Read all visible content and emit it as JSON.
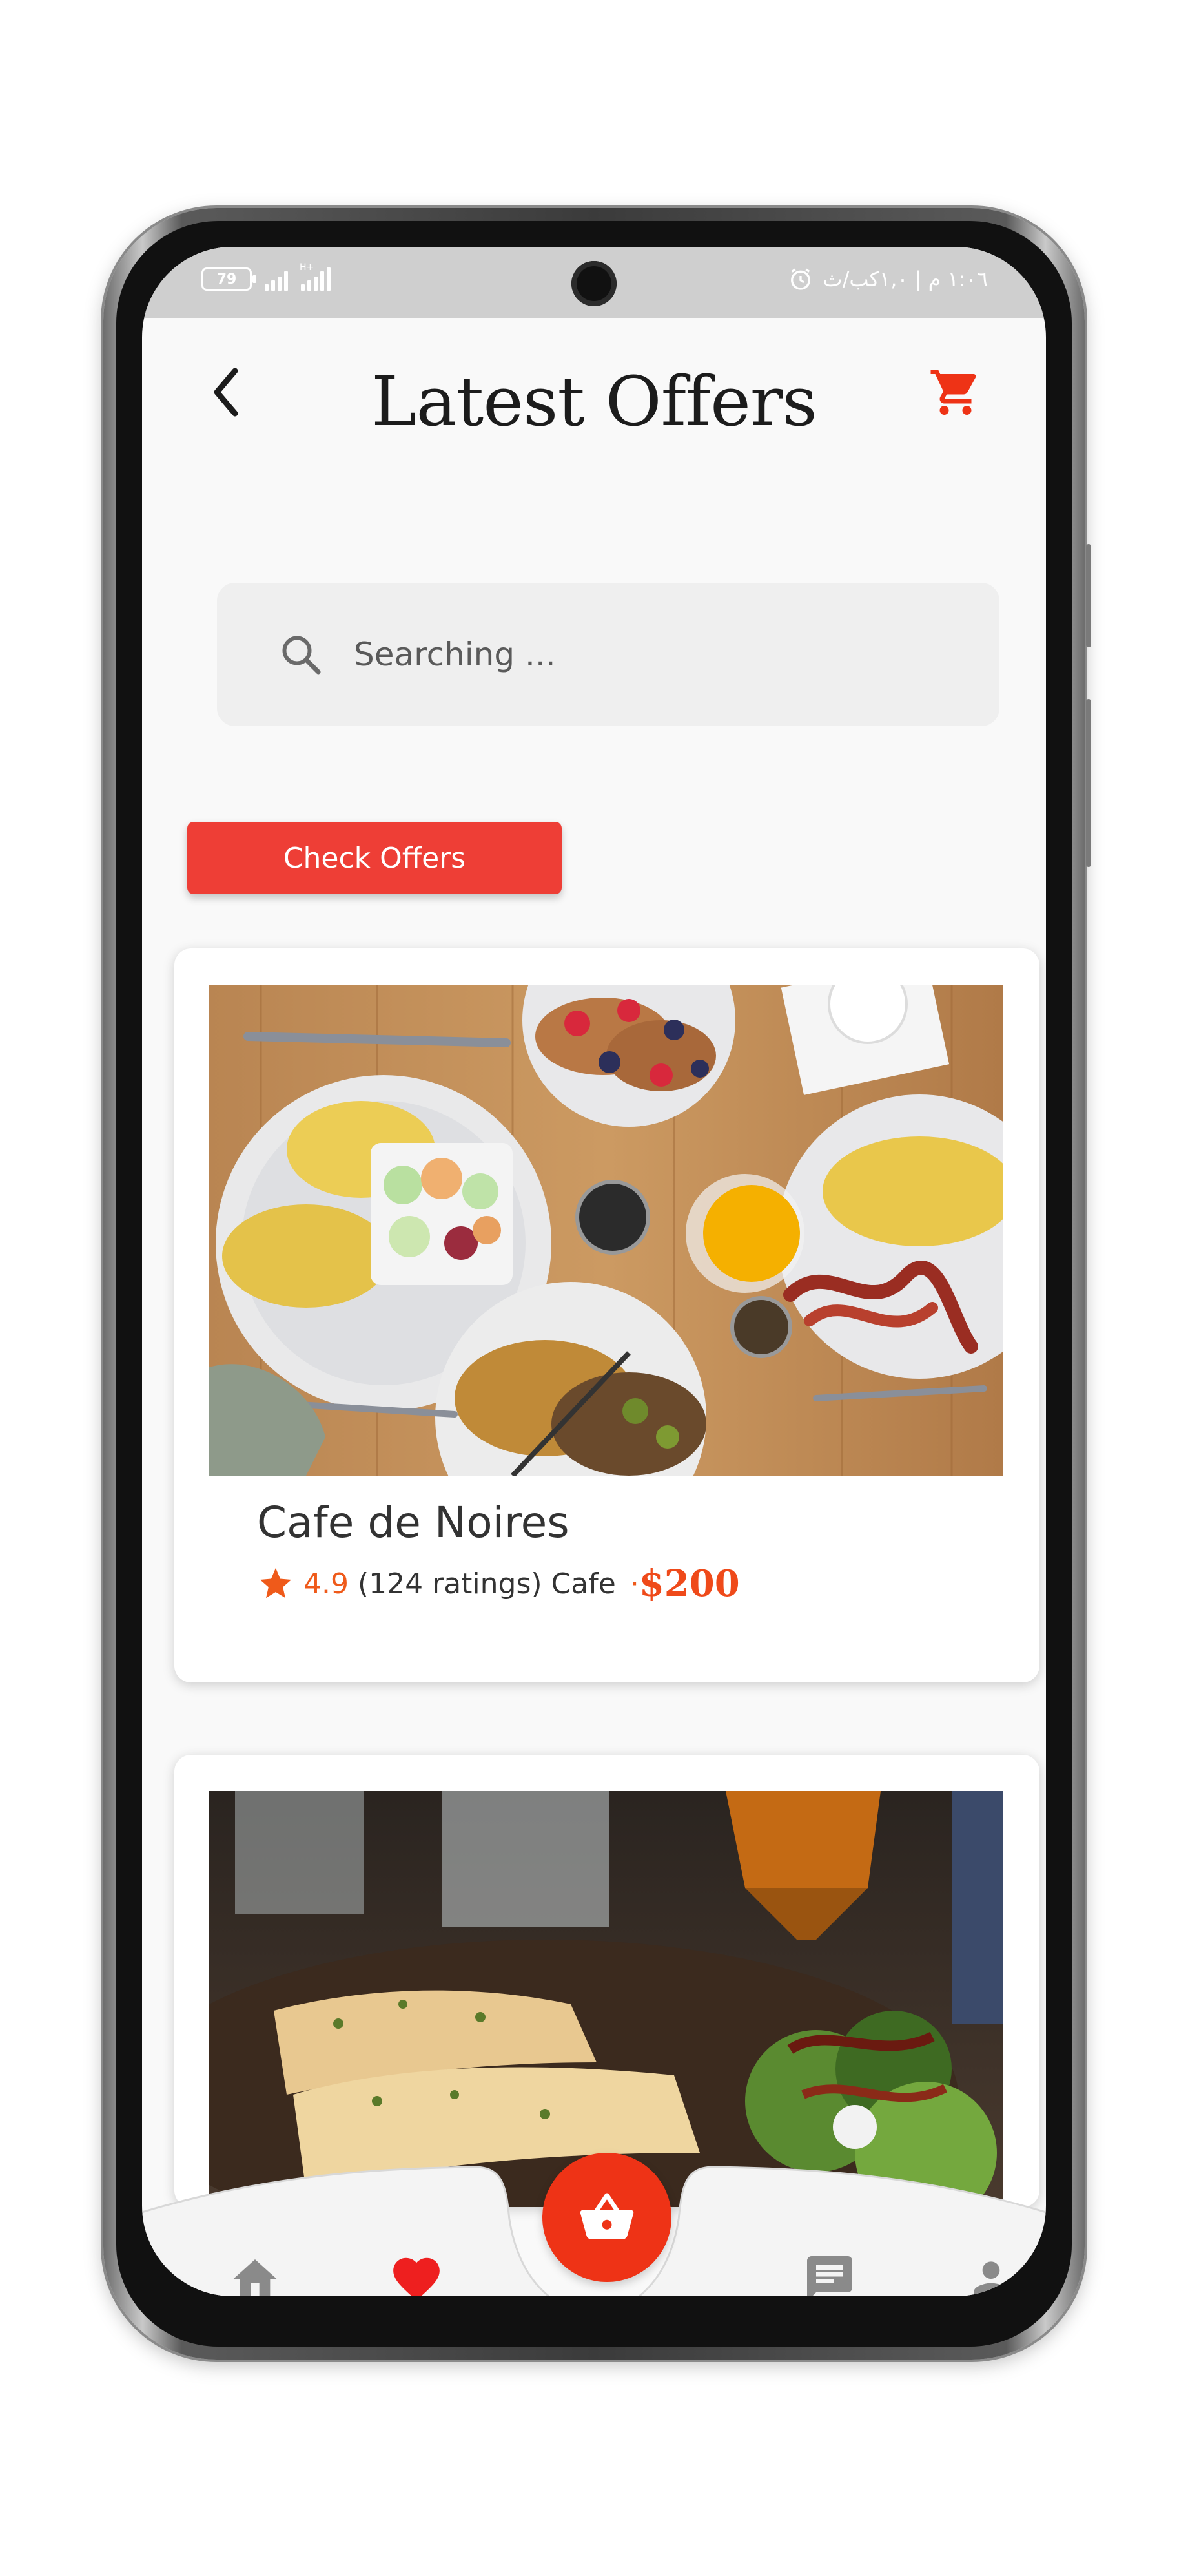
{
  "status_bar": {
    "battery": "79",
    "network_label": "H+",
    "right_text": "١:٠٦ م | ١,٠كب/ث"
  },
  "header": {
    "title": "Latest Offers",
    "back_icon": "chevron-left-icon",
    "cart_icon": "cart-icon"
  },
  "search": {
    "placeholder": "Searching ..."
  },
  "offers_button": {
    "label": "Check Offers"
  },
  "cards": [
    {
      "name": "Cafe de Noires",
      "rating": "4.9",
      "ratings_count": "(124 ratings)",
      "category": "Cafe",
      "separator": "·",
      "price": "$200"
    },
    {
      "name": "",
      "rating": "",
      "ratings_count": "",
      "category": "",
      "price": ""
    }
  ],
  "bottom_nav": {
    "items": [
      "home-icon",
      "heart-icon",
      "basket-icon",
      "chat-icon",
      "person-icon"
    ],
    "active": "heart-icon"
  },
  "colors": {
    "accent": "#EE3E36",
    "rating": "#EF5A1A",
    "fab": "#EE3316"
  }
}
